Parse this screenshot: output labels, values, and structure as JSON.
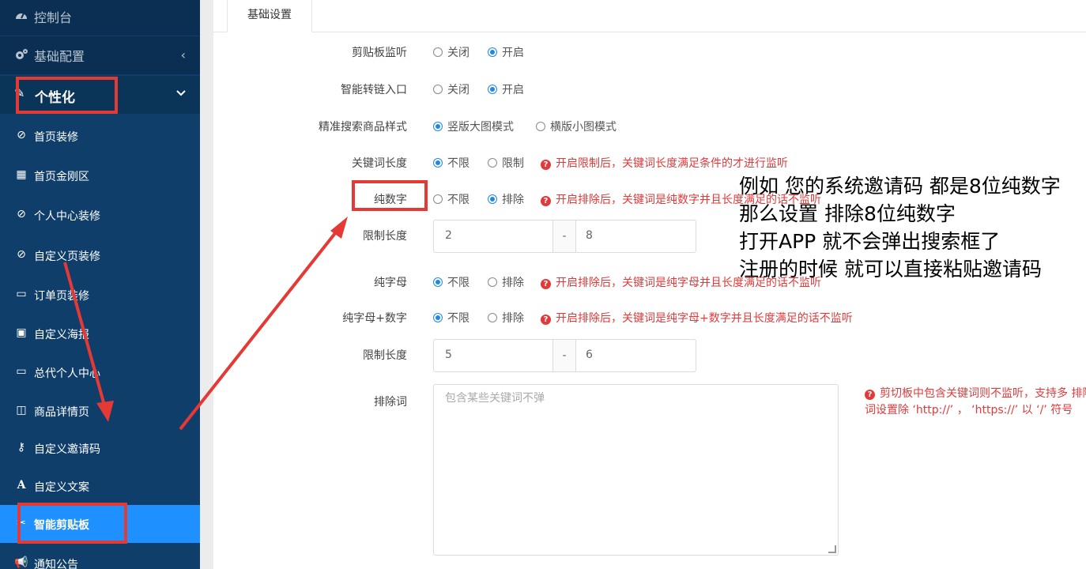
{
  "sidebar": {
    "top_items": [
      {
        "label": "控制台",
        "icon": "dashboard-icon"
      },
      {
        "label": "基础配置",
        "icon": "gears-icon"
      }
    ],
    "group": {
      "label": "个性化",
      "icon": "pencil-icon"
    },
    "sub_items": [
      {
        "label": "首页装修",
        "icon": "edit-icon"
      },
      {
        "label": "首页金刚区",
        "icon": "grid-icon"
      },
      {
        "label": "个人中心装修",
        "icon": "edit-icon"
      },
      {
        "label": "自定义页装修",
        "icon": "edit-icon"
      },
      {
        "label": "订单页装修",
        "icon": "window-icon"
      },
      {
        "label": "自定义海报",
        "icon": "image-icon"
      },
      {
        "label": "总代个人中心",
        "icon": "window-icon"
      },
      {
        "label": "商品详情页",
        "icon": "columns-icon"
      },
      {
        "label": "自定义邀请码",
        "icon": "key-icon"
      },
      {
        "label": "自定义文案",
        "icon": "font-icon"
      },
      {
        "label": "智能剪贴板",
        "icon": "scissors-icon"
      },
      {
        "label": "通知公告",
        "icon": "bullhorn-icon"
      }
    ],
    "active": "智能剪贴板"
  },
  "tabs": [
    {
      "label": "基础设置"
    }
  ],
  "form": {
    "clipboard_monitor": {
      "label": "剪贴板监听",
      "options": [
        "关闭",
        "开启"
      ],
      "selected": "开启"
    },
    "smart_link": {
      "label": "智能转链入口",
      "options": [
        "关闭",
        "开启"
      ],
      "selected": "开启"
    },
    "search_style": {
      "label": "精准搜索商品样式",
      "options": [
        "竖版大图模式",
        "横版小图模式"
      ],
      "selected": "竖版大图模式"
    },
    "keyword_length": {
      "label": "关键词长度",
      "options": [
        "不限",
        "限制"
      ],
      "selected": "不限",
      "hint": "开启限制后，关键词长度满足条件的才进行监听"
    },
    "pure_digits": {
      "label": "纯数字",
      "options": [
        "不限",
        "排除"
      ],
      "selected": "排除",
      "hint": "开启排除后，关键词是纯数字并且长度满足的话不监听"
    },
    "digits_length": {
      "label": "限制长度",
      "min": "2",
      "sep": "-",
      "max": "8"
    },
    "pure_letters": {
      "label": "纯字母",
      "options": [
        "不限",
        "排除"
      ],
      "selected": "不限",
      "hint": "开启排除后，关键词是纯字母并且长度满足的话不监听"
    },
    "letters_digits": {
      "label": "纯字母+数字",
      "options": [
        "不限",
        "排除"
      ],
      "selected": "不限",
      "hint": "开启排除后，关键词是纯字母+数字并且长度满足的话不监听"
    },
    "mix_length": {
      "label": "限制长度",
      "min": "5",
      "sep": "-",
      "max": "6"
    },
    "exclude_words": {
      "label": "排除词",
      "placeholder": "包含某些关键词不弹",
      "hint": "剪切板中包含关键词则不监听，支持多 排除词设置除 ‘http://’ ， ‘https://’ 以 ‘/’ 符号"
    }
  },
  "annotation": {
    "lines": [
      "例如 您的系统邀请码 都是8位纯数字",
      "那么设置 排除8位纯数字",
      "打开APP 就不会弹出搜索框了",
      "注册的时候  就可以直接粘贴邀请码"
    ],
    "color": "#e53935"
  }
}
